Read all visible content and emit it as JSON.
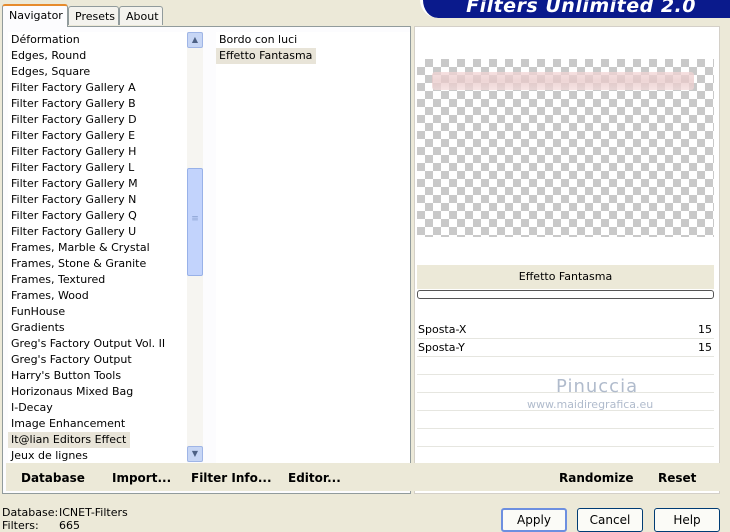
{
  "banner_title": "Filters Unlimited 2.0",
  "tabs": [
    {
      "label": "Navigator"
    },
    {
      "label": "Presets"
    },
    {
      "label": "About"
    }
  ],
  "categories": [
    "Déformation",
    "Edges, Round",
    "Edges, Square",
    "Filter Factory Gallery A",
    "Filter Factory Gallery B",
    "Filter Factory Gallery D",
    "Filter Factory Gallery E",
    "Filter Factory Gallery H",
    "Filter Factory Gallery L",
    "Filter Factory Gallery M",
    "Filter Factory Gallery N",
    "Filter Factory Gallery Q",
    "Filter Factory Gallery U",
    "Frames, Marble & Crystal",
    "Frames, Stone & Granite",
    "Frames, Textured",
    "Frames, Wood",
    "FunHouse",
    "Gradients",
    "Greg's Factory Output Vol. II",
    "Greg's Factory Output",
    "Harry's Button Tools",
    "Horizonaus Mixed Bag",
    "I-Decay",
    "Image Enhancement",
    "It@lian Editors Effect",
    "Jeux de lignes"
  ],
  "selected_category_index": 25,
  "filters": [
    "Bordo con luci",
    "Effetto Fantasma"
  ],
  "selected_filter_index": 1,
  "left_buttons": {
    "database": "Database",
    "import": "Import...",
    "filter_info": "Filter Info...",
    "editor": "Editor..."
  },
  "filter_name": "Effetto Fantasma",
  "params": [
    {
      "label": "Sposta-X",
      "value": "15"
    },
    {
      "label": "Sposta-Y",
      "value": "15"
    }
  ],
  "watermark": {
    "line1": "Pinuccia",
    "line2": "www.maidiregrafica.eu"
  },
  "right_buttons": {
    "randomize": "Randomize",
    "reset": "Reset"
  },
  "status": {
    "database_label": "Database:",
    "database_value": "ICNET-Filters",
    "filters_label": "Filters:",
    "filters_value": "665"
  },
  "dialog_buttons": {
    "apply": "Apply",
    "cancel": "Cancel",
    "help": "Help"
  },
  "colors": {
    "banner": "#0a1a8c",
    "panel": "#ece9d8",
    "selection": "#e8e4d8"
  }
}
